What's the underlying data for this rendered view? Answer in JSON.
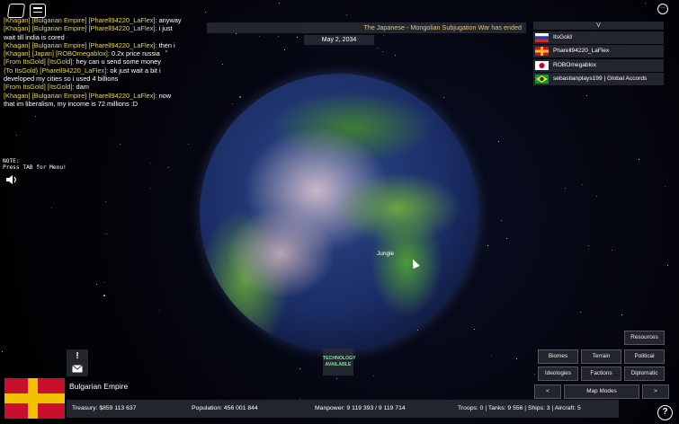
{
  "chat": [
    [
      {
        "t": "[Khagan] [Bulgarian Empire] [Pharell94220_LaFlex]:",
        "c": "y"
      },
      {
        "t": " anyway",
        "c": "w"
      }
    ],
    [
      {
        "t": "[Khagan] [Bulgarian Empire] [Pharell94220_LaFlex]:",
        "c": "y"
      },
      {
        "t": " i just",
        "c": "w"
      }
    ],
    [
      {
        "t": "wait till india is cored",
        "c": "w"
      }
    ],
    [
      {
        "t": "[Khagan] [Bulgarian Empire] [Pharell94220_LaFlex]:",
        "c": "y"
      },
      {
        "t": " then i",
        "c": "w"
      }
    ],
    [
      {
        "t": "[Khagan] [Japan] [ROBOmegablox]:",
        "c": "y"
      },
      {
        "t": " 0.2x price russia",
        "c": "w"
      }
    ],
    [
      {
        "t": "[From ItsGold] [ItsGold]:",
        "c": "y"
      },
      {
        "t": " hey can u send some money",
        "c": "w"
      }
    ],
    [
      {
        "t": "{To ItsGold} [Pharell94220_LaFlex]:",
        "c": "y"
      },
      {
        "t": " ok just wait a bit i",
        "c": "w"
      }
    ],
    [
      {
        "t": "developed my cities so i used 4 billions",
        "c": "w"
      }
    ],
    [
      {
        "t": "[From ItsGold] [ItsGold]:",
        "c": "y"
      },
      {
        "t": " dam",
        "c": "w"
      }
    ],
    [
      {
        "t": "[Khagan] [Bulgarian Empire] [Pharell94220_LaFlex]:",
        "c": "y"
      },
      {
        "t": " now",
        "c": "w"
      }
    ],
    [
      {
        "t": "that im liberalism, my income is 72 millions :D",
        "c": "w"
      }
    ]
  ],
  "banner": "The Japanese - Mongolian Subjugation War has ended",
  "date": "May 2, 2034",
  "player_list_header": "V",
  "players": [
    {
      "name": "ItsGold",
      "flag": "russia"
    },
    {
      "name": "Pharell94220_LaFlex",
      "flag": "bulgaria"
    },
    {
      "name": "ROBOmegablox",
      "flag": "japan"
    },
    {
      "name": "sebastianplays199 | Global Accords",
      "flag": "brazil"
    }
  ],
  "note_line1": "NOTE:",
  "note_line2": "Press TAB for Menu!",
  "map_label": "Jungle",
  "alert_symbol": "!",
  "tech_line1": "TECHNOLOGY",
  "tech_line2": "AVAILABLE",
  "nation_name": "Bulgarian Empire",
  "stats": {
    "treasury": "Treasury:  $859 113 637",
    "population": "Population: 456 001 844",
    "manpower": "Manpower:  9 119 393  /  9 119 714",
    "military": "Troops: 0  |  Tanks: 9 556  |  Ships: 3  |  Aircraft: 5"
  },
  "buttons": {
    "resources": "Resources",
    "biomes": "Biomes",
    "terrain": "Terrain",
    "political": "Political",
    "ideologies": "Ideologies",
    "factions": "Factions",
    "diplomatic": "Diplomatic",
    "prev": "<",
    "map_modes": "Map Modes",
    "next": ">"
  },
  "help_symbol": "?",
  "menu_symbol": "···",
  "colors": {
    "accent_yellow": "#e8d25a",
    "chat_green": "#7fd67a",
    "banner_text": "#e8c36a",
    "tech_text": "#7fe0a0"
  }
}
